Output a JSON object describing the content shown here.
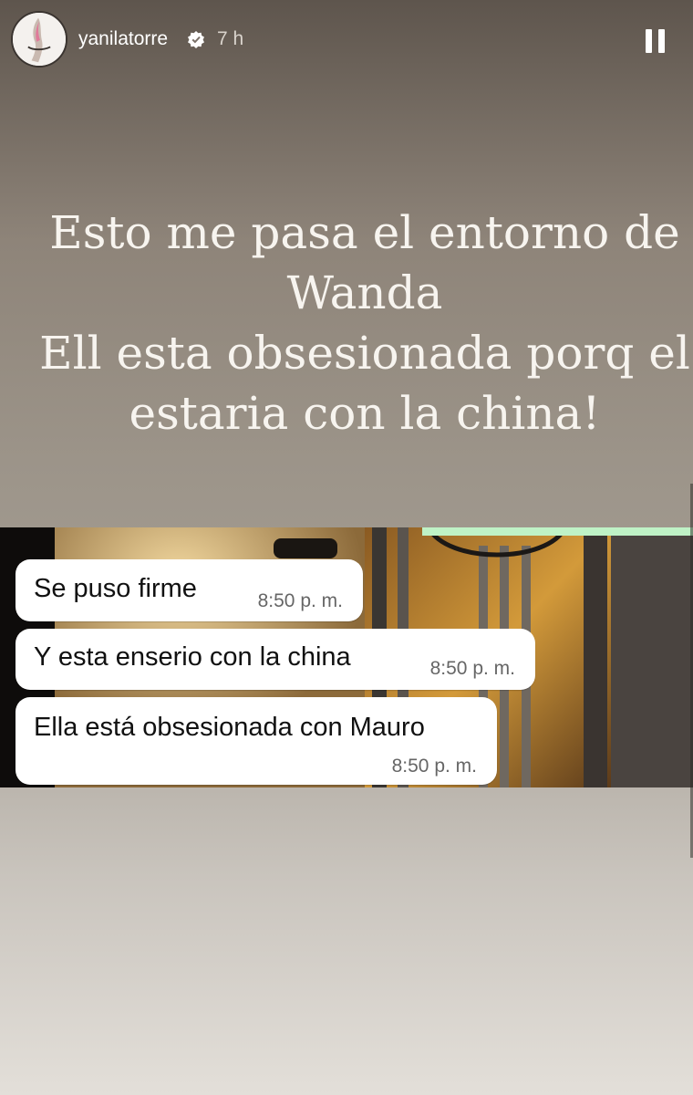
{
  "header": {
    "username": "yanilatorre",
    "time_ago": "7 h",
    "verified_icon": "verified-badge-icon",
    "pause_icon": "pause-icon"
  },
  "overlay": {
    "lines": [
      "Esto me pasa el entorno de",
      "Wanda",
      "Ell esta obsesionada porq el",
      "estaria con la china!"
    ]
  },
  "chat": {
    "messages": [
      {
        "text": "Se puso firme",
        "time": "8:50 p. m."
      },
      {
        "text": "Y esta enserio con la china",
        "time": "8:50 p. m."
      },
      {
        "text": "Ella está obsesionada con Mauro",
        "time": "8:50 p. m."
      }
    ]
  },
  "colors": {
    "overlay_text": "#f7f4ef",
    "accent_line": "#bff2c6",
    "bubble": "#ffffff"
  }
}
